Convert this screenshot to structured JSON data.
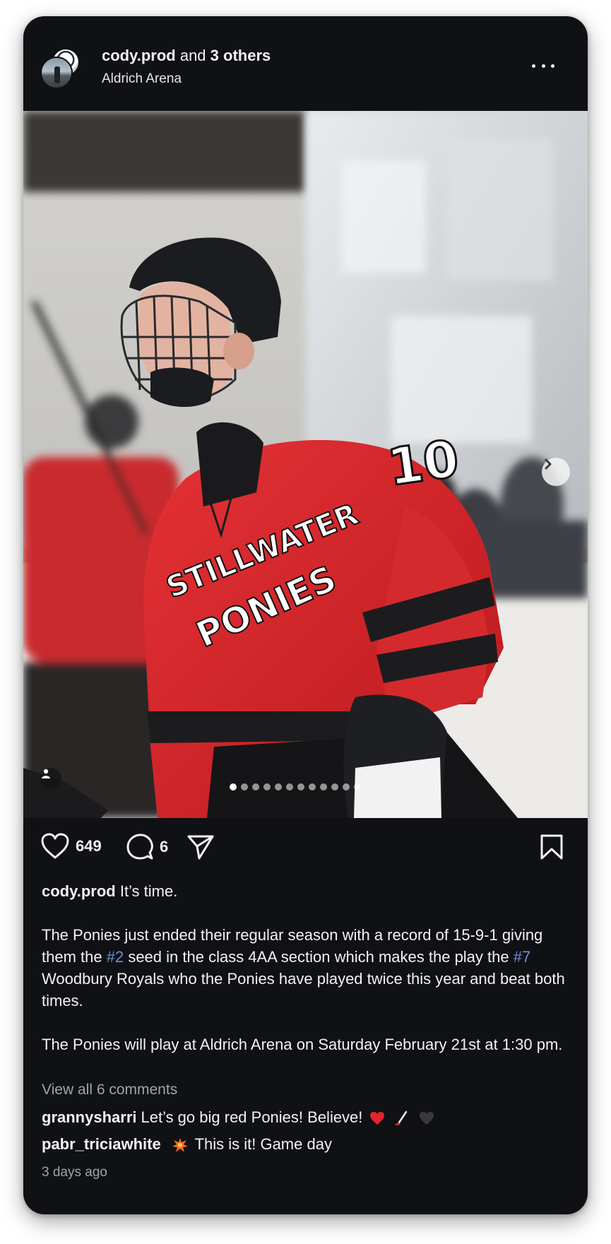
{
  "post": {
    "author": "cody.prod",
    "coauthors_connector": " and ",
    "coauthors": "3 others",
    "location": "Aldrich Arena",
    "likes": "649",
    "comments_count": "6",
    "photo_count": 12,
    "active_photo": 1,
    "caption_author": "cody.prod",
    "caption_title": "It’s time.",
    "caption_p1_a": "The Ponies just ended their regular season with a record of 15-9-1 giving them the ",
    "caption_p1_tag1": "#2",
    "caption_p1_b": " seed in the class 4AA section which makes the play the ",
    "caption_p1_tag2": "#7",
    "caption_p1_c": " Woodbury Royals who the Ponies have played twice this year and beat both times.",
    "caption_p2": "The Ponies will play at Aldrich Arena on Saturday February 21st at 1:30 pm.",
    "view_all": "View all 6 comments",
    "comments": [
      {
        "user": "grannysharri",
        "text": "Let’s go big red Ponies! Believe!"
      },
      {
        "user": "pabr_triciawhite",
        "text": "This is it! Game day"
      }
    ],
    "time_ago": "3 days ago",
    "jersey": {
      "team_line1": "STILLWATER",
      "team_line2": "PONIES",
      "number": "10"
    },
    "colors": {
      "card_bg": "#0f1114",
      "jersey_red": "#d42a2e",
      "hashtag": "#6e8fd6"
    }
  }
}
